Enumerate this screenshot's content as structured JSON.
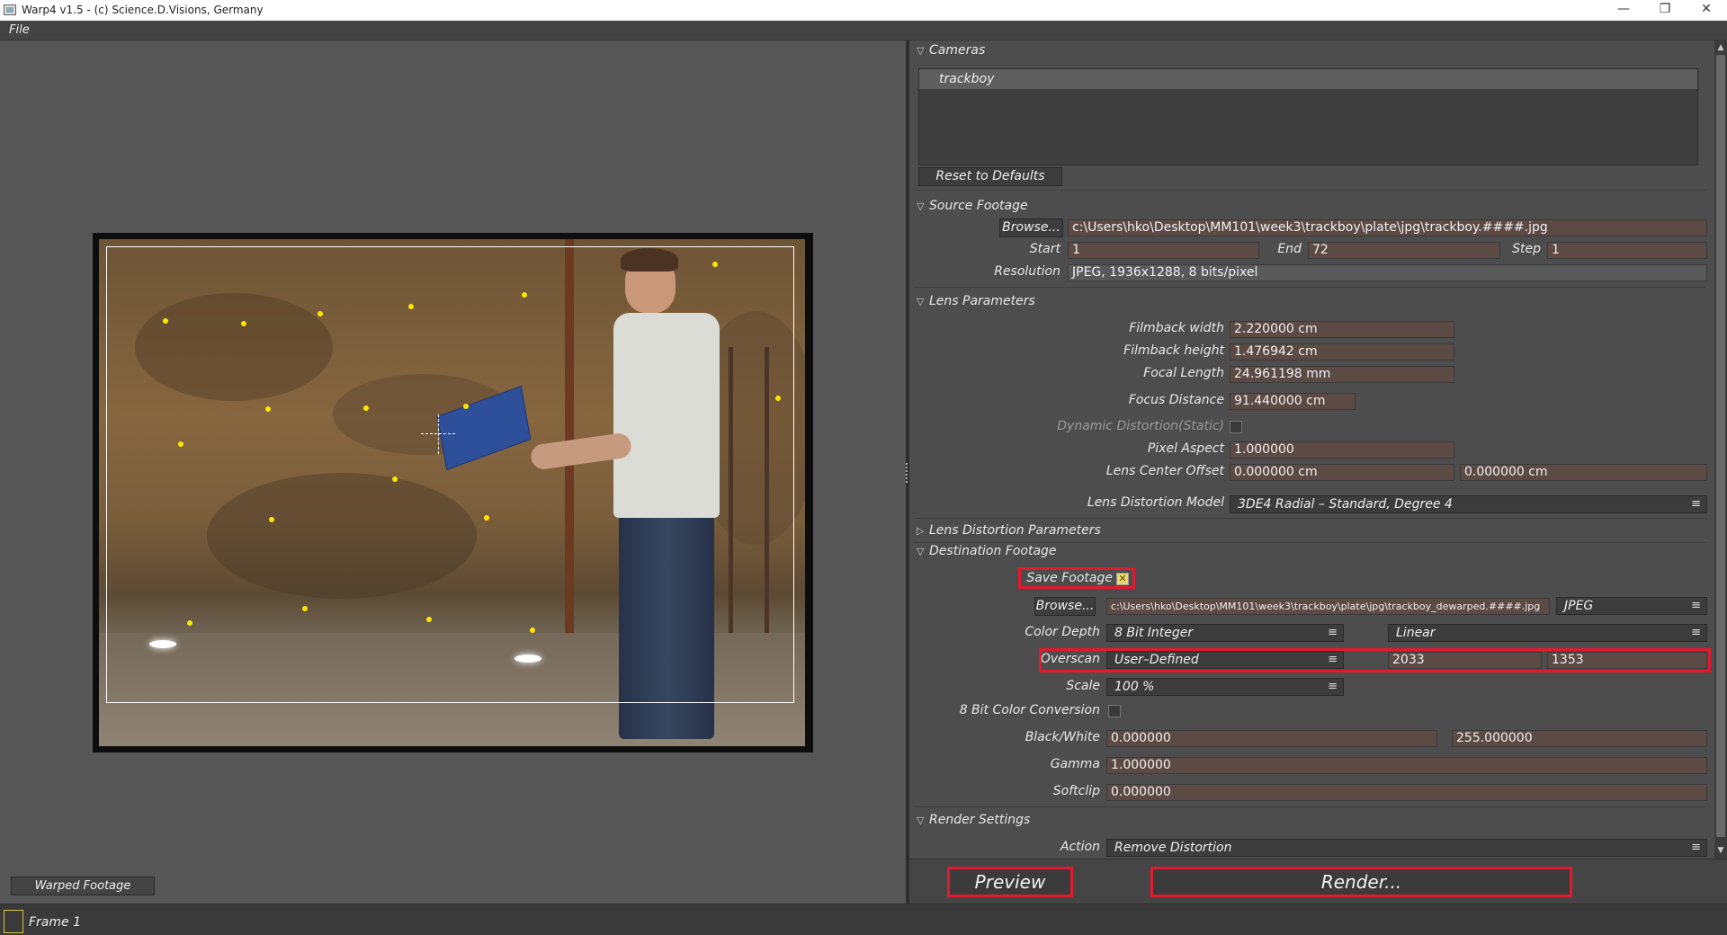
{
  "window": {
    "title": "Warp4  v1.5 - (c) Science.D.Visions, Germany",
    "minimize_glyph": "—",
    "restore_glyph": "❐",
    "close_glyph": "✕"
  },
  "menu": {
    "file": "File"
  },
  "viewer": {
    "warped_label": "Warped Footage"
  },
  "status": {
    "frame": "Frame 1"
  },
  "cameras": {
    "section": "Cameras",
    "items": [
      "trackboy"
    ],
    "reset_button": "Reset to Defaults"
  },
  "source": {
    "section": "Source Footage",
    "browse": "Browse...",
    "path": "c:\\Users\\hko\\Desktop\\MM101\\week3\\trackboy\\plate\\jpg\\trackboy.####.jpg",
    "start_label": "Start",
    "start": "1",
    "end_label": "End",
    "end": "72",
    "step_label": "Step",
    "step": "1",
    "resolution_label": "Resolution",
    "resolution": "JPEG, 1936x1288, 8 bits/pixel"
  },
  "lens": {
    "section": "Lens Parameters",
    "filmback_width_label": "Filmback width",
    "filmback_width": "2.220000 cm",
    "filmback_height_label": "Filmback height",
    "filmback_height": "1.476942 cm",
    "focal_length_label": "Focal Length",
    "focal_length": "24.961198 mm",
    "focus_distance_label": "Focus Distance",
    "focus_distance": "91.440000 cm",
    "dynamic_distortion_label": "Dynamic Distortion(Static)",
    "pixel_aspect_label": "Pixel Aspect",
    "pixel_aspect": "1.000000",
    "center_offset_label": "Lens Center Offset",
    "center_offset_x": "0.000000 cm",
    "center_offset_y": "0.000000 cm",
    "distortion_model_label": "Lens Distortion Model",
    "distortion_model": "3DE4 Radial – Standard, Degree 4"
  },
  "lens_distortion": {
    "section": "Lens Distortion Parameters"
  },
  "destination": {
    "section": "Destination Footage",
    "save_label": "Save Footage",
    "save_checked": true,
    "browse": "Browse...",
    "path": "c:\\Users\\hko\\Desktop\\MM101\\week3\\trackboy\\plate\\jpg\\trackboy_dewarped.####.jpg",
    "format": "JPEG",
    "color_depth_label": "Color Depth",
    "color_depth": "8 Bit Integer",
    "color_space": "Linear",
    "overscan_label": "Overscan",
    "overscan": "User–Defined",
    "overscan_w": "2033",
    "overscan_h": "1353",
    "scale_label": "Scale",
    "scale": "100 %",
    "color_conv_label": "8 Bit Color Conversion",
    "black_white_label": "Black/White",
    "black": "0.000000",
    "white": "255.000000",
    "gamma_label": "Gamma",
    "gamma": "1.000000",
    "softclip_label": "Softclip",
    "softclip": "0.000000"
  },
  "render": {
    "section": "Render Settings",
    "action_label": "Action",
    "action": "Remove Distortion"
  },
  "buttons": {
    "preview": "Preview",
    "render": "Render..."
  },
  "icons": {
    "expanded": "▽",
    "collapsed": "▷",
    "menu": "≡",
    "check": "✕",
    "scroll_up": "▲",
    "scroll_down": "▼"
  },
  "colors": {
    "highlight": "#e3192f",
    "track_point": "#ffe600"
  }
}
